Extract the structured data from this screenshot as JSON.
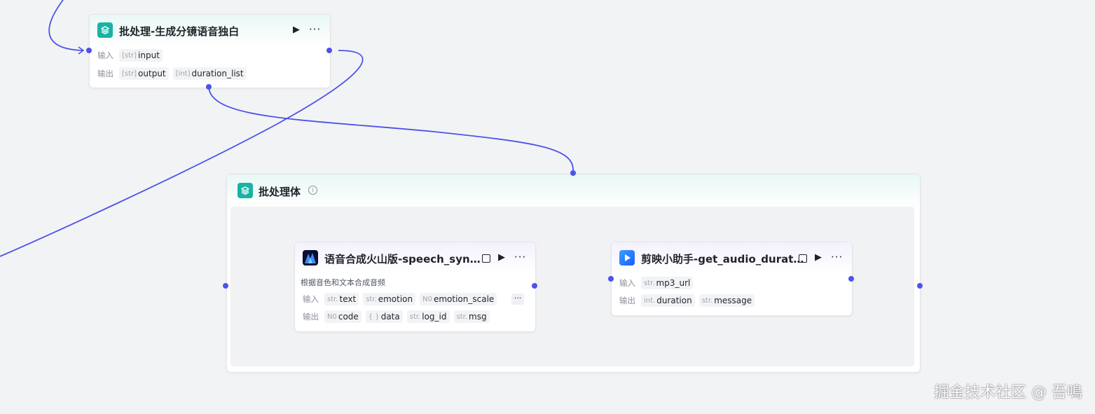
{
  "nodes": {
    "batch_top": {
      "title": "批处理-生成分镜语音独白",
      "input_label": "输入",
      "output_label": "输出",
      "inputs": [
        {
          "type": "[str]",
          "name": "input"
        }
      ],
      "outputs": [
        {
          "type": "[str]",
          "name": "output"
        },
        {
          "type": "[int]",
          "name": "duration_list"
        }
      ]
    },
    "batch_body": {
      "title": "批处理体",
      "info_icon": "info-icon"
    },
    "speech": {
      "title": "语音合成火山版-speech_syn…",
      "description": "根据音色和文本合成音频",
      "input_label": "输入",
      "output_label": "输出",
      "inputs": [
        {
          "type": "str.",
          "name": "text"
        },
        {
          "type": "str.",
          "name": "emotion"
        },
        {
          "type": "N0",
          "name": "emotion_scale"
        }
      ],
      "more_params": "···",
      "outputs": [
        {
          "type": "N0",
          "name": "code"
        },
        {
          "type": "{ }",
          "name": "data"
        },
        {
          "type": "str.",
          "name": "log_id"
        },
        {
          "type": "str.",
          "name": "msg"
        }
      ]
    },
    "jianying": {
      "title": "剪映小助手-get_audio_durat…",
      "input_label": "输入",
      "output_label": "输出",
      "inputs": [
        {
          "type": "str.",
          "name": "mp3_url"
        }
      ],
      "outputs": [
        {
          "type": "int.",
          "name": "duration"
        },
        {
          "type": "str.",
          "name": "message"
        }
      ]
    }
  },
  "actions": {
    "run_icon": "▶",
    "more_label": "···"
  },
  "watermark": "掘金技术社区 @ 吾鳴",
  "colors": {
    "wire": "#4d53e8",
    "batch_accent": "#17b3a4"
  }
}
